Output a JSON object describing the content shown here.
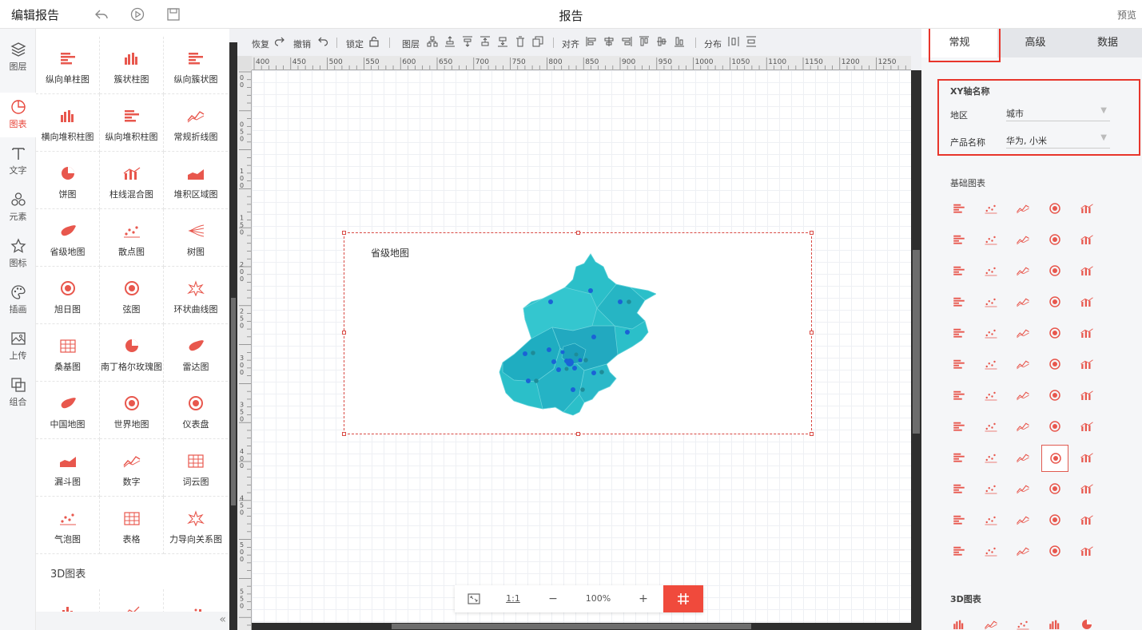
{
  "topbar": {
    "app_title": "编辑报告",
    "page_title": "报告",
    "preview": "预览"
  },
  "leftnav": [
    {
      "label": "图层",
      "icon": "layers-icon"
    },
    {
      "label": "图表",
      "icon": "chart-icon",
      "active": true
    },
    {
      "label": "文字",
      "icon": "text-icon"
    },
    {
      "label": "元素",
      "icon": "elements-icon"
    },
    {
      "label": "图标",
      "icon": "star-icon"
    },
    {
      "label": "插画",
      "icon": "palette-icon"
    },
    {
      "label": "上传",
      "icon": "upload-image-icon"
    },
    {
      "label": "组合",
      "icon": "group-icon"
    }
  ],
  "library": {
    "items": [
      "纵向单柱图",
      "簇状柱图",
      "纵向簇状图",
      "横向堆积柱图",
      "纵向堆积柱图",
      "常规折线图",
      "饼图",
      "柱线混合图",
      "堆积区域图",
      "省级地图",
      "散点图",
      "树图",
      "旭日图",
      "弦图",
      "环状曲线图",
      "桑基图",
      "南丁格尔玫瑰图",
      "雷达图",
      "中国地图",
      "世界地图",
      "仪表盘",
      "漏斗图",
      "数字",
      "词云图",
      "气泡图",
      "表格",
      "力导向关系图"
    ],
    "section_3d": "3D图表",
    "collapse_icon": "double-chevron-left-icon"
  },
  "toolbar": {
    "redo": "恢复",
    "undo": "撤销",
    "lock": "锁定",
    "layer": "图层",
    "align": "对齐",
    "distribute": "分布"
  },
  "ruler": {
    "h_ticks": [
      "400",
      "450",
      "500",
      "550",
      "600",
      "650",
      "700",
      "750",
      "800",
      "850",
      "900",
      "950",
      "1000",
      "1050",
      "1100",
      "1150",
      "1200",
      "1250"
    ],
    "v_ticks": [
      "0\n0",
      "0\n5\n0",
      "1\n0\n0",
      "1\n5\n0",
      "2\n0\n0",
      "2\n5\n0",
      "3\n0\n0",
      "3\n5\n0",
      "4\n0\n0",
      "4\n5\n0",
      "5\n0\n0",
      "5\n5\n0"
    ]
  },
  "widget": {
    "title": "省级地图"
  },
  "zoombar": {
    "ratio": "1:1",
    "minus": "−",
    "zoom": "100%",
    "plus": "+"
  },
  "rightpanel": {
    "tabs": [
      "常规",
      "高级",
      "数据"
    ],
    "active_tab": 0,
    "xy_title": "XY轴名称",
    "fields": [
      {
        "label": "地区",
        "value": "城市"
      },
      {
        "label": "产品名称",
        "value": "华为, 小米"
      }
    ],
    "basic_charts": "基础图表",
    "charts_3d": "3D图表"
  },
  "colors": {
    "accent": "#f04a3c",
    "icon_red": "#e8574d",
    "map_teal": "#2bbfc9",
    "map_point": "#1a63d6"
  }
}
